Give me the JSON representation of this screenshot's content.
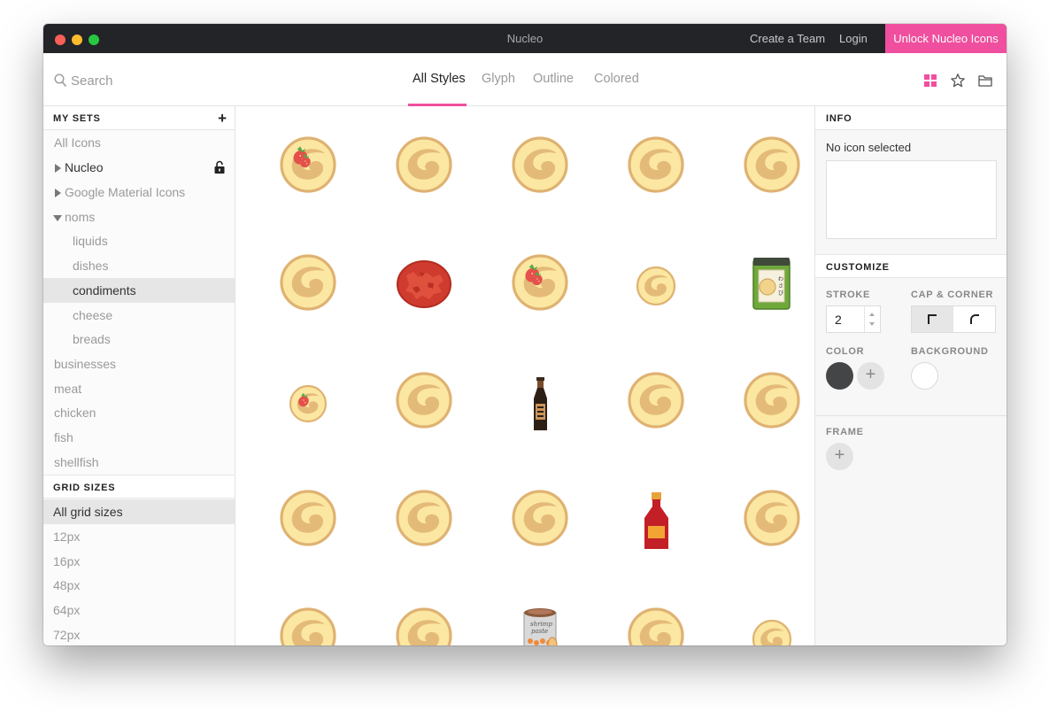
{
  "window": {
    "title": "Nucleo",
    "create_team": "Create a Team",
    "login": "Login",
    "unlock": "Unlock Nucleo Icons"
  },
  "toolbar": {
    "search_placeholder": "Search",
    "tabs": [
      "All Styles",
      "Glyph",
      "Outline",
      "Colored"
    ],
    "active_tab": "All Styles",
    "view_icons": [
      "grid-view-icon",
      "star-icon",
      "folder-icon"
    ]
  },
  "sidebar": {
    "my_sets_header": "MY SETS",
    "sets": [
      {
        "label": "All Icons"
      },
      {
        "label": "Nucleo",
        "expander": "collapsed",
        "locked": true
      },
      {
        "label": "Google Material Icons",
        "expander": "collapsed"
      },
      {
        "label": "noms",
        "expander": "expanded"
      },
      {
        "label": "liquids",
        "child": true
      },
      {
        "label": "dishes",
        "child": true
      },
      {
        "label": "condiments",
        "child": true,
        "selected": true
      },
      {
        "label": "cheese",
        "child": true
      },
      {
        "label": "breads",
        "child": true
      },
      {
        "label": "businesses"
      },
      {
        "label": "meat"
      },
      {
        "label": "chicken"
      },
      {
        "label": "fish"
      },
      {
        "label": "shellfish"
      }
    ],
    "grid_sizes_header": "GRID SIZES",
    "grid_sizes": [
      {
        "label": "All grid sizes",
        "selected": true
      },
      {
        "label": "12px"
      },
      {
        "label": "16px"
      },
      {
        "label": "48px"
      },
      {
        "label": "64px"
      },
      {
        "label": "72px"
      }
    ]
  },
  "grid": {
    "icons": [
      "pancake-strawberry",
      "pancake",
      "pancake",
      "pancake",
      "pancake",
      "pancake",
      "ground-meat",
      "pancake-strawberry",
      "pancake-small",
      "wasabi-jar",
      "pancake-small-strawberry",
      "pancake",
      "soy-sauce-bottle",
      "pancake",
      "pancake",
      "pancake",
      "pancake",
      "pancake",
      "ketchup-bottle",
      "pancake",
      "pancake",
      "pancake",
      "shrimp-paste-can",
      "pancake",
      "pancake-small"
    ],
    "can_label_1": "shrimp",
    "can_label_2": "paste",
    "jar_label": "わさび"
  },
  "panel": {
    "info_header": "INFO",
    "no_icon": "No icon selected",
    "customize_header": "CUSTOMIZE",
    "stroke_label": "STROKE",
    "stroke_value": "2",
    "cap_label": "CAP & CORNER",
    "color_label": "COLOR",
    "background_label": "BACKGROUND",
    "frame_label": "FRAME",
    "plus": "+",
    "color_value": "#444547",
    "background_value": "#ffffff"
  },
  "colors": {
    "accent": "#ef4f9e",
    "titlebar": "#232428",
    "pancake_fill": "#fbe7a1",
    "pancake_rim": "#dfb272"
  }
}
